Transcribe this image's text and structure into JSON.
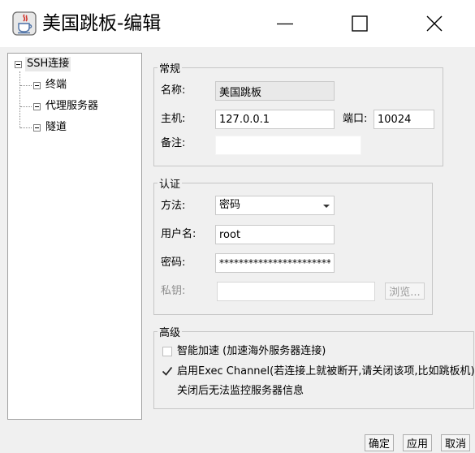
{
  "window": {
    "title": "美国跳板-编辑",
    "app_icon": "java-coffee-cup-icon"
  },
  "tree": {
    "root": "SSH连接",
    "children": [
      "终端",
      "代理服务器",
      "隧道"
    ]
  },
  "general": {
    "legend": "常规",
    "name_label": "名称:",
    "name_value": "美国跳板",
    "host_label": "主机:",
    "host_value": "127.0.0.1",
    "port_label": "端口:",
    "port_value": "10024",
    "note_label": "备注:",
    "note_value": ""
  },
  "auth": {
    "legend": "认证",
    "method_label": "方法:",
    "method_value": "密码",
    "user_label": "用户名:",
    "user_value": "root",
    "password_label": "密码:",
    "password_value": "************************",
    "key_label": "私钥:",
    "key_value": "",
    "browse_label": "浏览..."
  },
  "advanced": {
    "legend": "高级",
    "smart_accel_label": "智能加速 (加速海外服务器连接)",
    "smart_accel_checked": false,
    "exec_channel_label": "启用Exec Channel(若连接上就被断开,请关闭该项,比如跳板机)",
    "exec_channel_checked": true,
    "exec_channel_note": "关闭后无法监控服务器信息"
  },
  "buttons": {
    "ok": "确定",
    "apply": "应用",
    "cancel": "取消"
  }
}
